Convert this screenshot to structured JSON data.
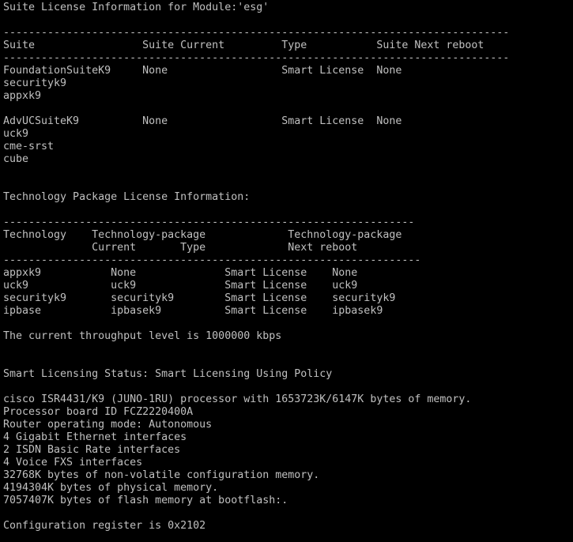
{
  "terminal": {
    "colors": {
      "background": "#000000",
      "foreground": "#c0c0c0"
    },
    "lines": [
      "Suite License Information for Module:'esg'",
      "",
      "--------------------------------------------------------------------------------",
      "Suite                 Suite Current         Type           Suite Next reboot",
      "--------------------------------------------------------------------------------",
      "FoundationSuiteK9     None                  Smart License  None",
      "securityk9",
      "appxk9",
      "",
      "AdvUCSuiteK9          None                  Smart License  None",
      "uck9",
      "cme-srst",
      "cube",
      "",
      "",
      "Technology Package License Information:",
      "",
      "-----------------------------------------------------------------",
      "Technology    Technology-package             Technology-package",
      "              Current       Type             Next reboot",
      "------------------------------------------------------------------",
      "appxk9           None              Smart License    None",
      "uck9             uck9              Smart License    uck9",
      "securityk9       securityk9        Smart License    securityk9",
      "ipbase           ipbasek9          Smart License    ipbasek9",
      "",
      "The current throughput level is 1000000 kbps",
      "",
      "",
      "Smart Licensing Status: Smart Licensing Using Policy",
      "",
      "cisco ISR4431/K9 (JUNO-1RU) processor with 1653723K/6147K bytes of memory.",
      "Processor board ID FCZ2220400A",
      "Router operating mode: Autonomous",
      "4 Gigabit Ethernet interfaces",
      "2 ISDN Basic Rate interfaces",
      "4 Voice FXS interfaces",
      "32768K bytes of non-volatile configuration memory.",
      "4194304K bytes of physical memory.",
      "7057407K bytes of flash memory at bootflash:.",
      "",
      "Configuration register is 0x2102"
    ]
  }
}
